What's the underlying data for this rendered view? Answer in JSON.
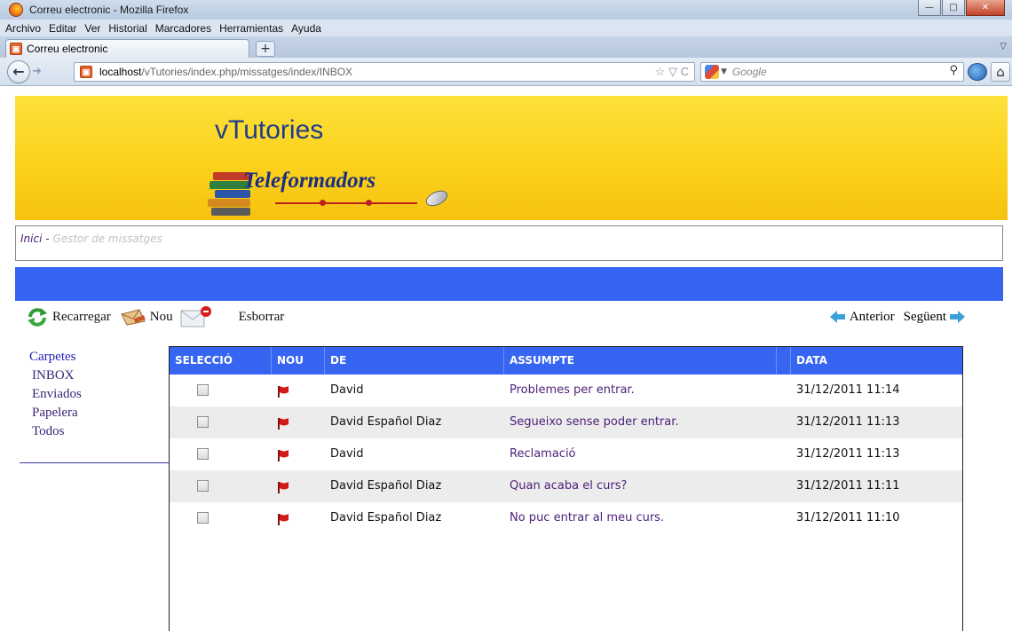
{
  "window": {
    "title": "Correu electronic - Mozilla Firefox",
    "controls": [
      "minimize-icon",
      "maximize-icon",
      "close-icon"
    ]
  },
  "menubar": {
    "items": [
      "Archivo",
      "Editar",
      "Ver",
      "Historial",
      "Marcadores",
      "Herramientas",
      "Ayuda"
    ]
  },
  "tabs": [
    {
      "label": "Correu electronic",
      "active": true
    }
  ],
  "navbar": {
    "url_host": "localhost",
    "url_path": "/vTutories/index.php/missatges/index/INBOX",
    "search_placeholder": "Google"
  },
  "banner": {
    "title": "vTutories",
    "subtitle": "Teleformadors"
  },
  "breadcrumb": {
    "home": "Inici",
    "separator": " - ",
    "current": "Gestor de missatges"
  },
  "toolbar": {
    "reload_label": "Recarregar",
    "new_label": "Nou",
    "delete_label": "Esborrar",
    "prev_label": "Anterior",
    "next_label": "Següent"
  },
  "sidebar": {
    "heading": "Carpetes",
    "folders": [
      "INBOX",
      "Enviados",
      "Papelera",
      "Todos"
    ]
  },
  "table": {
    "headers": [
      "SELECCIÓ",
      "NOU",
      "DE",
      "ASSUMPTE",
      "",
      "DATA"
    ],
    "rows": [
      {
        "checked": false,
        "new": true,
        "from": "David",
        "subject": "Problemes per entrar.",
        "date": "31/12/2011 11:14"
      },
      {
        "checked": false,
        "new": true,
        "from": "David Español Diaz",
        "subject": "Segueixo sense poder entrar.",
        "date": "31/12/2011 11:13"
      },
      {
        "checked": false,
        "new": true,
        "from": "David",
        "subject": "Reclamació",
        "date": "31/12/2011 11:13"
      },
      {
        "checked": false,
        "new": true,
        "from": "David Español Diaz",
        "subject": "Quan acaba el curs?",
        "date": "31/12/2011 11:11"
      },
      {
        "checked": false,
        "new": true,
        "from": "David Español Diaz",
        "subject": "No puc entrar al meu curs.",
        "date": "31/12/2011 11:10"
      }
    ]
  },
  "colors": {
    "accent_blue": "#3665f2",
    "banner_yellow": "#fbd01a",
    "link_purple": "#4b1f7a",
    "flag_red": "#d11a1a"
  }
}
